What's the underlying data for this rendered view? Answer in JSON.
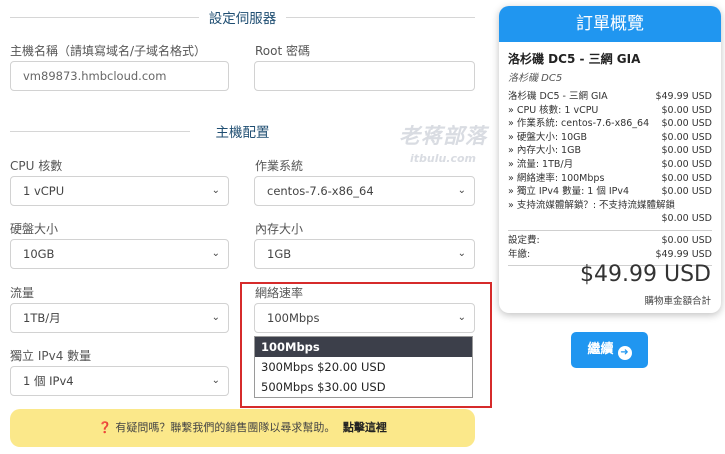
{
  "server_section": {
    "title": "設定伺服器",
    "hostname_label": "主機名稱（請填寫域名/子域名格式）",
    "hostname_value": "vm89873.hmbcloud.com",
    "root_label": "Root 密碼",
    "root_value": ""
  },
  "config_section": {
    "title": "主機配置",
    "cpu_label": "CPU 核數",
    "cpu_value": "1 vCPU",
    "os_label": "作業系統",
    "os_value": "centos-7.6-x86_64",
    "disk_label": "硬盤大小",
    "disk_value": "10GB",
    "ram_label": "內存大小",
    "ram_value": "1GB",
    "traffic_label": "流量",
    "traffic_value": "1TB/月",
    "speed_label": "網絡速率",
    "speed_value": "100Mbps",
    "ipv4_label": "獨立 IPv4 數量",
    "ipv4_value": "1 個 IPv4",
    "speed_options": [
      "100Mbps",
      "300Mbps $20.00 USD",
      "500Mbps $30.00 USD"
    ]
  },
  "help": {
    "icon": "question-circle-icon",
    "text": "有疑問嗎？聯繫我們的銷售團隊以尋求幫助。",
    "link": "點擊這裡"
  },
  "watermark": {
    "line1": "老蒋部落",
    "line2": "itbulu.com"
  },
  "summary": {
    "title": "訂單概覽",
    "product_name": "洛杉磯 DC5 - 三網 GIA",
    "product_group": "洛杉磯 DC5",
    "items": [
      {
        "label": "洛杉磯 DC5 - 三網 GIA",
        "price": "$49.99 USD"
      },
      {
        "label": "» CPU 核數: 1 vCPU",
        "price": "$0.00 USD"
      },
      {
        "label": "» 作業系統: centos-7.6-x86_64",
        "price": "$0.00 USD"
      },
      {
        "label": "» 硬盤大小: 10GB",
        "price": "$0.00 USD"
      },
      {
        "label": "» 內存大小: 1GB",
        "price": "$0.00 USD"
      },
      {
        "label": "» 流量: 1TB/月",
        "price": "$0.00 USD"
      },
      {
        "label": "» 網絡速率: 100Mbps",
        "price": "$0.00 USD"
      },
      {
        "label": "» 獨立 IPv4 數量: 1 個 IPv4",
        "price": "$0.00 USD"
      },
      {
        "label": "» 支持流媒體解鎖？: 不支持流媒體解鎖",
        "price": ""
      }
    ],
    "unlock_price": "$0.00 USD",
    "setup_label": "設定費:",
    "setup_price": "$0.00 USD",
    "annual_label": "年繳:",
    "annual_price": "$49.99 USD",
    "total": "$49.99 USD",
    "total_label": "購物車金額合計"
  },
  "continue_label": "繼續",
  "colors": {
    "accent": "#2096f0",
    "highlight": "#d62b2b",
    "help_bg": "#fbe88a"
  }
}
